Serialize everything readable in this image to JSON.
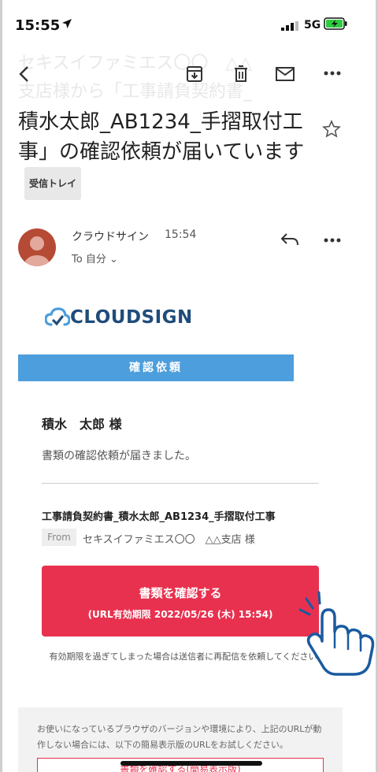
{
  "status": {
    "time": "15:55",
    "network": "5G"
  },
  "toolbar": {
    "ghost_line1": "セキスイファミエス〇〇　△△",
    "ghost_line2": "支店様から「工事請負契約書_"
  },
  "email": {
    "subject": "積水太郎_AB1234_手摺取付工事」の確認依頼が届いています",
    "folder_badge": "受信トレイ",
    "sender": "クラウドサイン",
    "time": "15:54",
    "to": "To 自分 ⌄"
  },
  "body": {
    "logo": "CLOUDSIGN",
    "banner": "確認依頼",
    "recipient": "積水　太郎 様",
    "intro": "書類の確認依頼が届きました。",
    "document_title": "工事請負契約書_積水太郎_AB1234_手摺取付工事",
    "from_label": "From",
    "from_value": "セキスイファミエス〇〇　△△支店 様",
    "confirm_button": "書類を確認する",
    "confirm_expiry": "(URL有効期限 2022/05/26 (木) 15:54)",
    "expiry_note": "有効期限を過ぎてしまった場合は送信者に再配信を依頼してください。",
    "browser_note": "お使いになっているブラウザのバージョンや環境により、上記のURLが動作しない場合には、以下の簡易表示版のURLをお試しください。",
    "simple_link": "書類を確認する(簡易表示版)"
  },
  "colors": {
    "accent": "#e8314f",
    "banner": "#4d9edc",
    "logo": "#1f4c7a",
    "avatar": "#b54a35",
    "hand": "#1a5aa0"
  }
}
